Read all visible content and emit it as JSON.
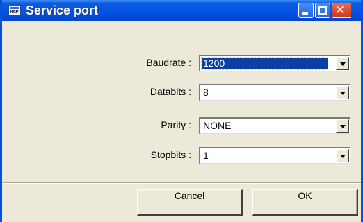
{
  "window": {
    "title": "Service port",
    "app_icon_text": "ЯAP"
  },
  "titlebar_buttons": {
    "minimize_glyph": "",
    "maximize_glyph": "",
    "close_glyph": "✕"
  },
  "fields": [
    {
      "label": "Baudrate :",
      "value": "1200",
      "focused": true
    },
    {
      "label": "Databits :",
      "value": "8",
      "focused": false
    },
    {
      "label": "Parity :",
      "value": "NONE",
      "focused": false
    },
    {
      "label": "Stopbits :",
      "value": "1",
      "focused": false
    }
  ],
  "buttons": {
    "cancel": {
      "mnemonic": "C",
      "rest": "ancel"
    },
    "ok": {
      "mnemonic": "O",
      "rest": "K"
    }
  },
  "colors": {
    "titlebar": "#0454e6",
    "selection": "#0a3fa6",
    "face": "#ece9d8"
  }
}
